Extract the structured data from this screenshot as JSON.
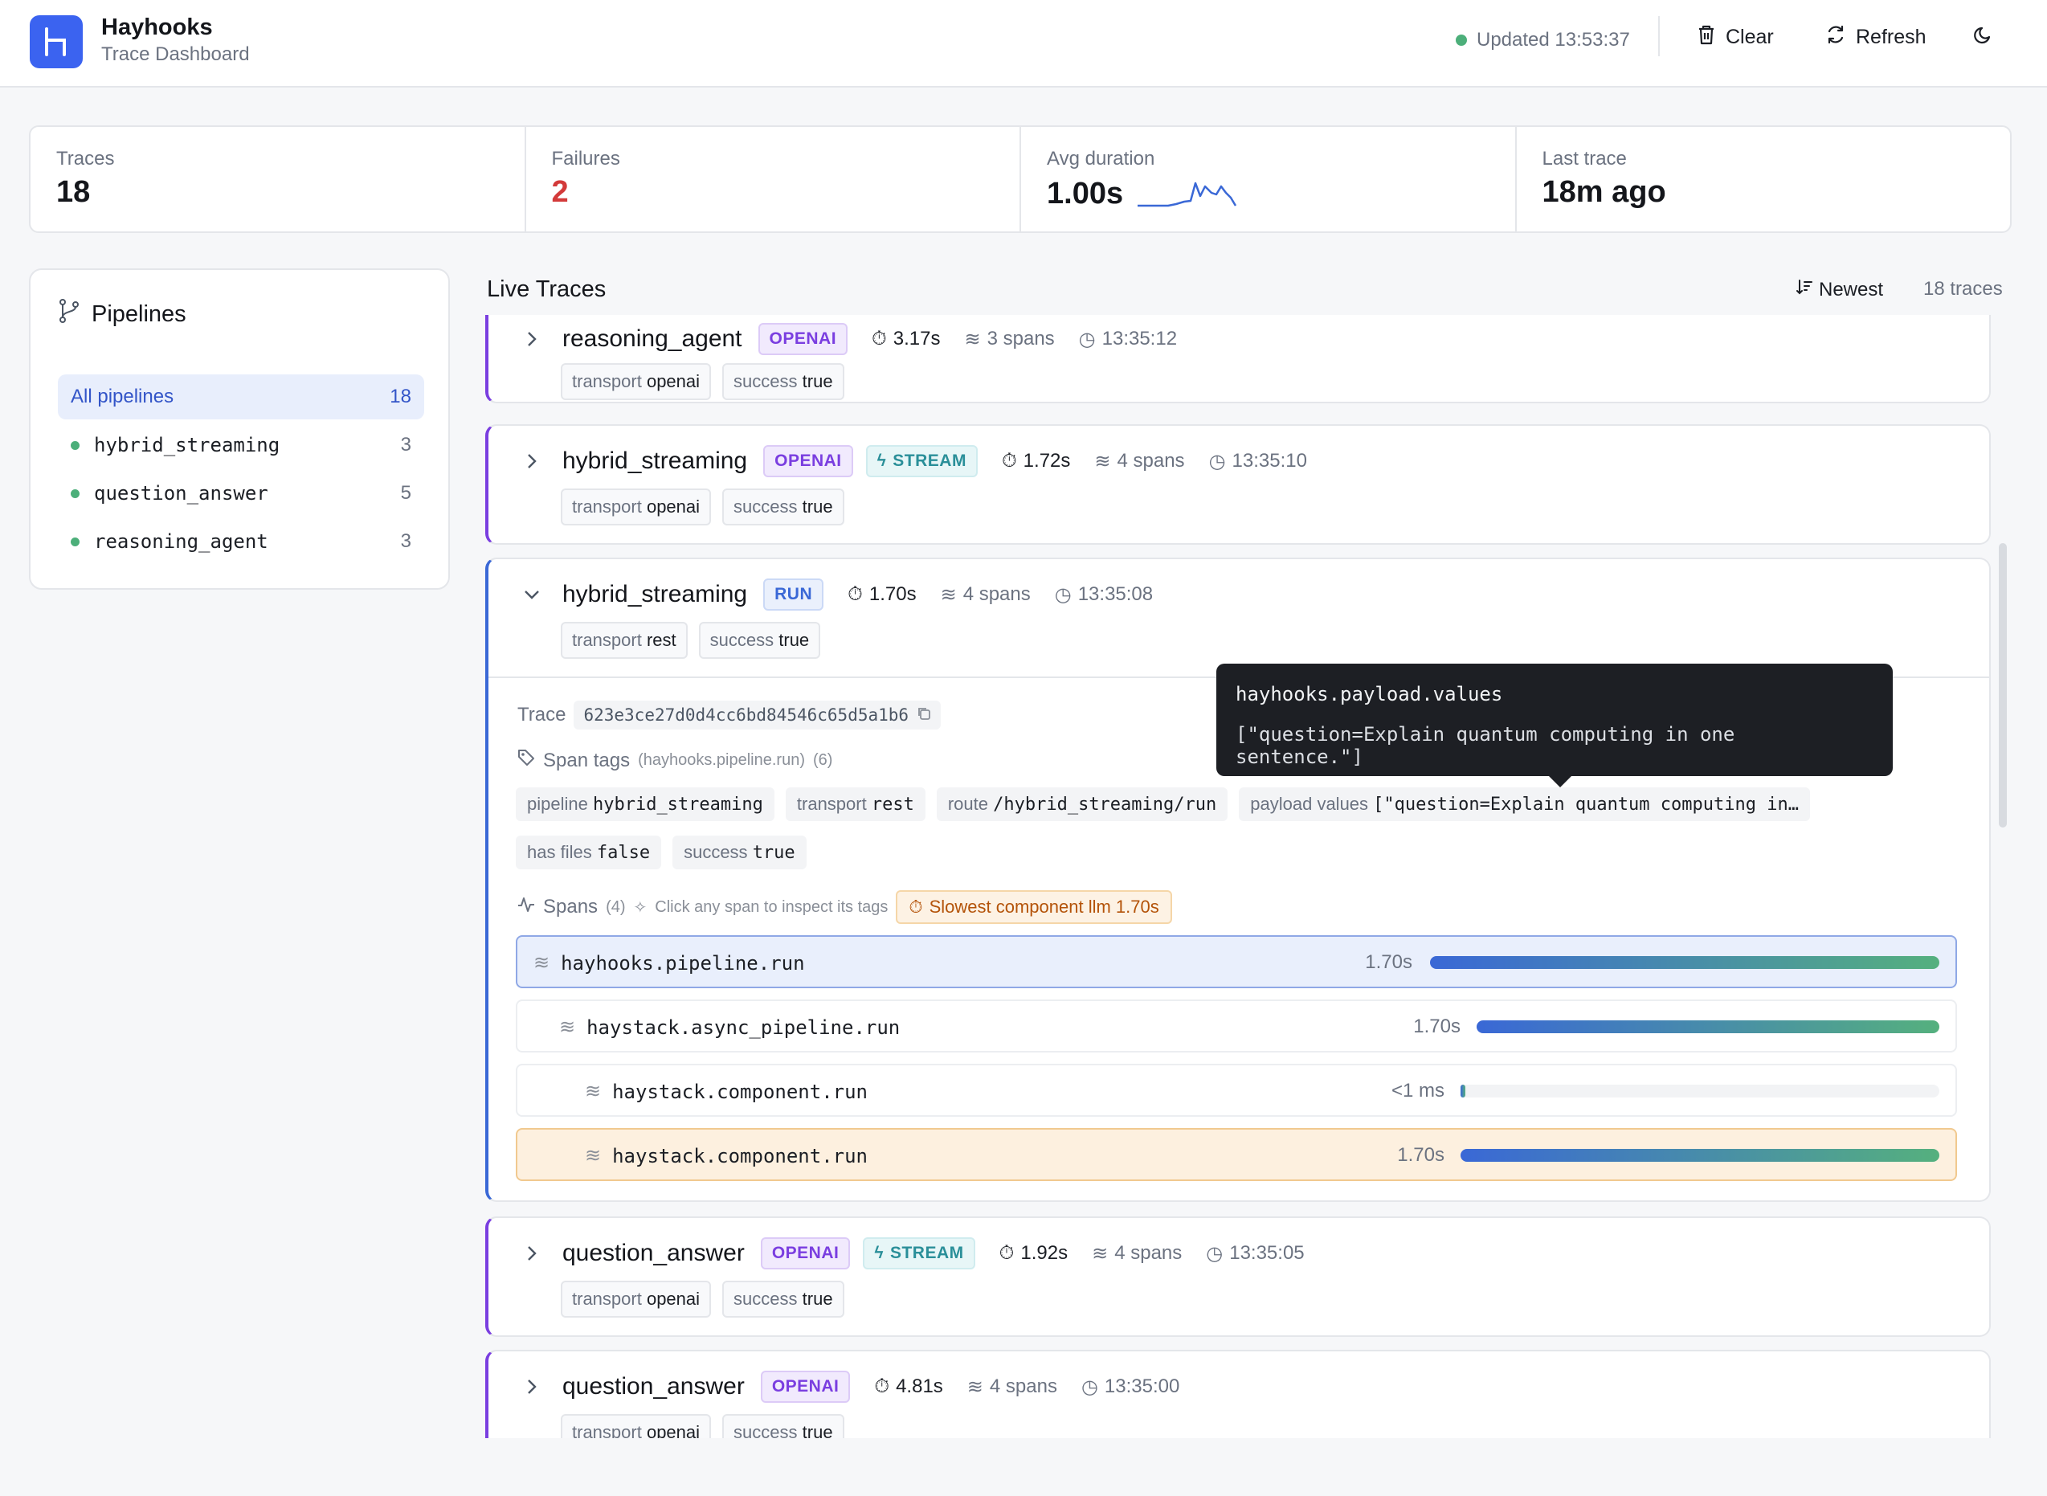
{
  "app": {
    "name": "Hayhooks",
    "subtitle": "Trace Dashboard",
    "updated": "Updated 13:53:37"
  },
  "toolbar": {
    "clear_label": "Clear",
    "refresh_label": "Refresh"
  },
  "stats": {
    "traces_label": "Traces",
    "traces_value": "18",
    "failures_label": "Failures",
    "failures_value": "2",
    "avg_label": "Avg duration",
    "avg_value": "1.00s",
    "last_label": "Last trace",
    "last_value": "18m ago"
  },
  "pipelines": {
    "title": "Pipelines",
    "items": [
      {
        "label": "All pipelines",
        "count": "18"
      },
      {
        "label": "hybrid_streaming",
        "count": "3"
      },
      {
        "label": "question_answer",
        "count": "5"
      },
      {
        "label": "reasoning_agent",
        "count": "3"
      }
    ]
  },
  "live": {
    "title": "Live Traces",
    "sort_label": "Newest",
    "count_label": "18 traces"
  },
  "traces": [
    {
      "name": "reasoning_agent",
      "badge": "OPENAI",
      "duration": "3.17s",
      "spans": "3 spans",
      "time": "13:35:12",
      "tags": [
        {
          "k": "transport",
          "v": "openai"
        },
        {
          "k": "success",
          "v": "true"
        }
      ]
    },
    {
      "name": "hybrid_streaming",
      "badge": "OPENAI",
      "stream": "STREAM",
      "duration": "1.72s",
      "spans": "4 spans",
      "time": "13:35:10",
      "tags": [
        {
          "k": "transport",
          "v": "openai"
        },
        {
          "k": "success",
          "v": "true"
        }
      ]
    },
    {
      "name": "hybrid_streaming",
      "badge": "RUN",
      "duration": "1.70s",
      "spans": "4 spans",
      "time": "13:35:08",
      "tags": [
        {
          "k": "transport",
          "v": "rest"
        },
        {
          "k": "success",
          "v": "true"
        }
      ]
    },
    {
      "name": "question_answer",
      "badge": "OPENAI",
      "stream": "STREAM",
      "duration": "1.92s",
      "spans": "4 spans",
      "time": "13:35:05",
      "tags": [
        {
          "k": "transport",
          "v": "openai"
        },
        {
          "k": "success",
          "v": "true"
        }
      ]
    },
    {
      "name": "question_answer",
      "badge": "OPENAI",
      "duration": "4.81s",
      "spans": "4 spans",
      "time": "13:35:00",
      "tags": [
        {
          "k": "transport",
          "v": "openai"
        },
        {
          "k": "success",
          "v": "true"
        }
      ]
    }
  ],
  "detail": {
    "trace_label": "Trace",
    "trace_id": "623e3ce27d0d4cc6bd84546c65d5a1b6",
    "span_tags_label": "Span tags",
    "span_tags_source": "(hayhooks.pipeline.run)",
    "span_tags_count": "(6)",
    "span_tags": [
      {
        "k": "pipeline",
        "v": "hybrid_streaming"
      },
      {
        "k": "transport",
        "v": "rest"
      },
      {
        "k": "route",
        "v": "/hybrid_streaming/run"
      },
      {
        "k": "payload values",
        "v": "[\"question=Explain quantum computing in…"
      },
      {
        "k": "has files",
        "v": "false"
      },
      {
        "k": "success",
        "v": "true"
      }
    ],
    "spans_label": "Spans",
    "spans_count": "(4)",
    "spans_hint": "Click any span to inspect its tags",
    "slowest": "Slowest component llm 1.70s",
    "spans": [
      {
        "name": "hayhooks.pipeline.run",
        "duration": "1.70s",
        "fraction": 1.0
      },
      {
        "name": "haystack.async_pipeline.run",
        "duration": "1.70s",
        "fraction": 1.0
      },
      {
        "name": "haystack.component.run",
        "duration": "<1 ms",
        "fraction": 0.0
      },
      {
        "name": "haystack.component.run",
        "duration": "1.70s",
        "fraction": 1.0
      }
    ]
  },
  "tooltip": {
    "key": "hayhooks.payload.values",
    "value": "[\"question=Explain quantum computing in one sentence.\"]"
  }
}
